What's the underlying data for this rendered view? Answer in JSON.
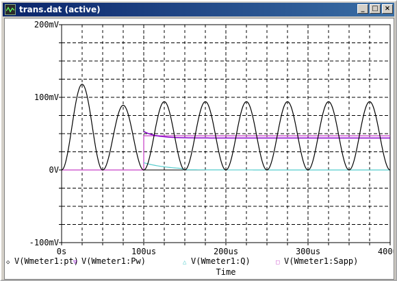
{
  "window": {
    "title": "trans.dat (active)",
    "icon": "probe-waveform-icon",
    "buttons": {
      "minimize": "_",
      "maximize": "□",
      "close": "×"
    }
  },
  "chart_data": {
    "type": "line",
    "x_label": "Time",
    "x_ticks": [
      "0s",
      "100us",
      "200us",
      "300us",
      "400us"
    ],
    "y_ticks": [
      "200mV",
      "100mV",
      "0V",
      "-100mV"
    ],
    "xlim_us": [
      0,
      400
    ],
    "ylim_mV": [
      -100,
      200
    ],
    "grid": true,
    "legend_position": "bottom",
    "series": [
      {
        "name": "V(Wmeter1:pt)",
        "marker": "◇",
        "color": "#000000"
      },
      {
        "name": "V(Wmeter1:Pw)",
        "marker": "▽",
        "color": "#8800cc"
      },
      {
        "name": "V(Wmeter1:Q)",
        "marker": "△",
        "color": "#55cccc"
      },
      {
        "name": "V(Wmeter1:Sapp)",
        "marker": "□",
        "color": "#d060d0"
      }
    ],
    "pt_peaks_mV": [
      118,
      89,
      94,
      94,
      94,
      94,
      94,
      94
    ],
    "pw_mV": {
      "start": 53,
      "steady": 44
    },
    "q_mV": {
      "start": 10
    },
    "sapp_mV": {
      "steady": 47
    }
  }
}
